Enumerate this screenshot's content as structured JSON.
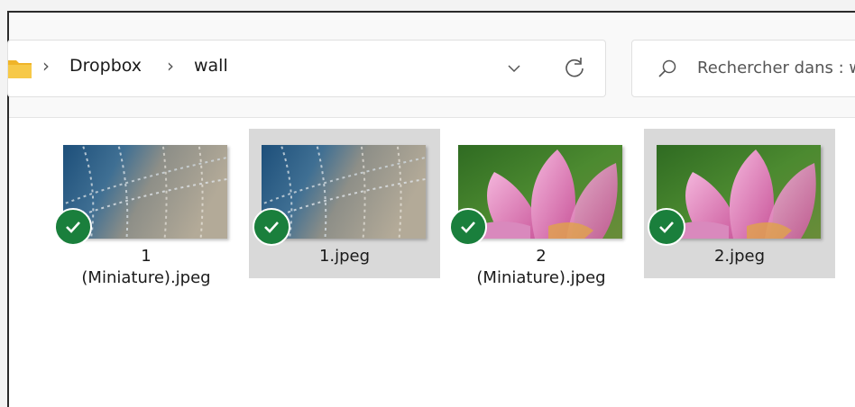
{
  "breadcrumb": {
    "items": [
      "Dropbox",
      "wall"
    ],
    "separator": "›"
  },
  "search": {
    "placeholder": "Rechercher dans : wall"
  },
  "files": [
    {
      "name": "1 (Miniature).jpeg",
      "display_name": "1\n(Miniature).jpeg",
      "thumbnail": "dew-web",
      "selected": false,
      "status": "synced"
    },
    {
      "name": "1.jpeg",
      "display_name": "1.jpeg",
      "thumbnail": "dew-web",
      "selected": true,
      "status": "synced"
    },
    {
      "name": "2 (Miniature).jpeg",
      "display_name": "2\n(Miniature).jpeg",
      "thumbnail": "pink-lotus",
      "selected": false,
      "status": "synced"
    },
    {
      "name": "2.jpeg",
      "display_name": "2.jpeg",
      "thumbnail": "pink-lotus",
      "selected": true,
      "status": "synced"
    }
  ],
  "colors": {
    "sync_green": "#1a7f3c",
    "selection": "#d9d9d9",
    "folder_yellow": "#f0b429"
  },
  "icons": [
    "folder-icon",
    "chevron-right-icon",
    "chevron-down-icon",
    "refresh-icon",
    "search-icon",
    "checkmark-icon"
  ]
}
